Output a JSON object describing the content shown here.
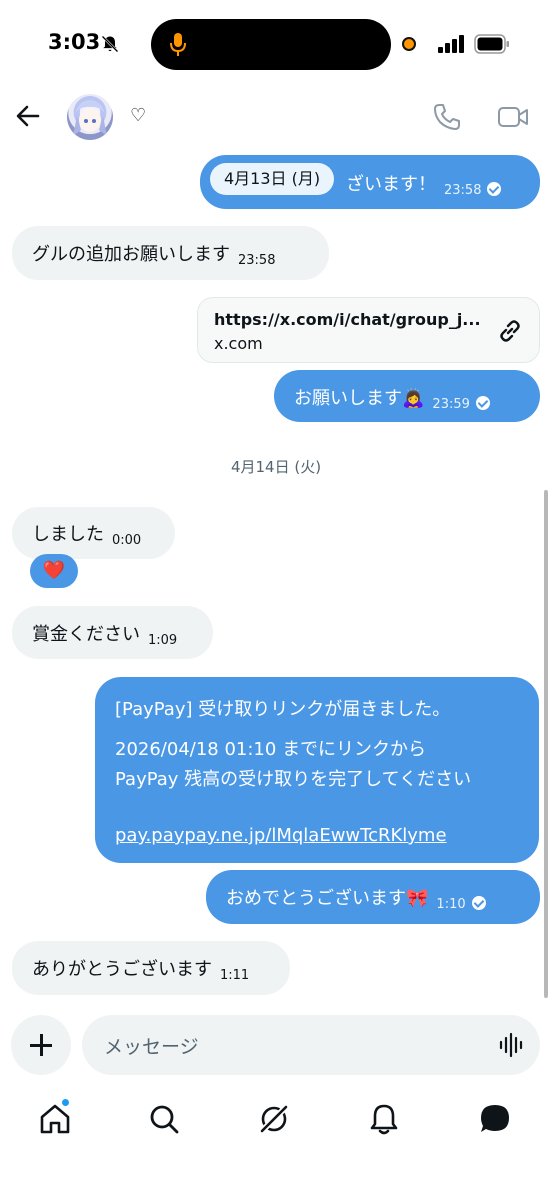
{
  "status_bar": {
    "time": "3:03"
  },
  "header": {
    "heart_symbol": "♡"
  },
  "messages": {
    "m1": {
      "date_pill": "4月13日 (月)",
      "text": "ざいます！",
      "time": "23:58"
    },
    "m2": {
      "text": "グルの追加お願いします",
      "time": "23:58"
    },
    "link_card": {
      "url": "https://x.com/i/chat/group_j...",
      "domain": "x.com"
    },
    "m3": {
      "text": "お願いします🙇‍♀️",
      "time": "23:59"
    },
    "date_separator": "4月14日 (火)",
    "m4": {
      "text": "しました",
      "time": "0:00",
      "reaction": "❤️"
    },
    "m5": {
      "text": "賞金ください",
      "time": "1:09"
    },
    "paypay": {
      "line1": "[PayPay] 受け取りリンクが届きました。",
      "line2": "2026/04/18 01:10 までにリンクから",
      "line3": "PayPay 残高の受け取りを完了してください",
      "link": "pay.paypay.ne.jp/lMqlaEwwTcRKlyme"
    },
    "m6": {
      "text": "おめでとうございます🎀",
      "time": "1:10"
    },
    "m7": {
      "text": "ありがとうございます",
      "time": "1:11"
    }
  },
  "composer": {
    "placeholder": "メッセージ"
  },
  "colors": {
    "accent": "#4a97e6",
    "incoming": "#eff3f4",
    "text": "#0f1419",
    "muted": "#536471"
  },
  "icons": [
    "back-arrow-icon",
    "heart-icon",
    "phone-icon",
    "video-icon",
    "link-icon",
    "plus-icon",
    "voice-icon",
    "home-icon",
    "search-icon",
    "grok-icon",
    "bell-icon",
    "messages-icon"
  ]
}
